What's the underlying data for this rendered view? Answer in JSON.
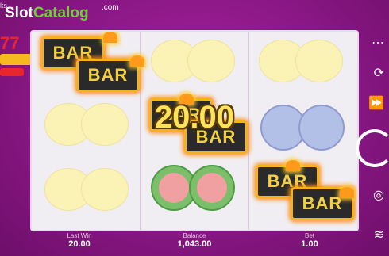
{
  "watermark": {
    "part1": "Slot",
    "part2": "Catalog",
    "suffix": ".com",
    "cut_text": "ks"
  },
  "reels": {
    "bar_label": "BAR"
  },
  "win": {
    "amount": "20.00"
  },
  "info": {
    "last_win": {
      "label": "Last Win",
      "value": "20.00"
    },
    "balance": {
      "label": "Balance",
      "value": "1,043.00"
    },
    "bet": {
      "label": "Bet",
      "value": "1.00"
    }
  },
  "colors": {
    "background": "#8a1785",
    "win_text": "#fde35a",
    "bar_border": "#f4b21b"
  }
}
